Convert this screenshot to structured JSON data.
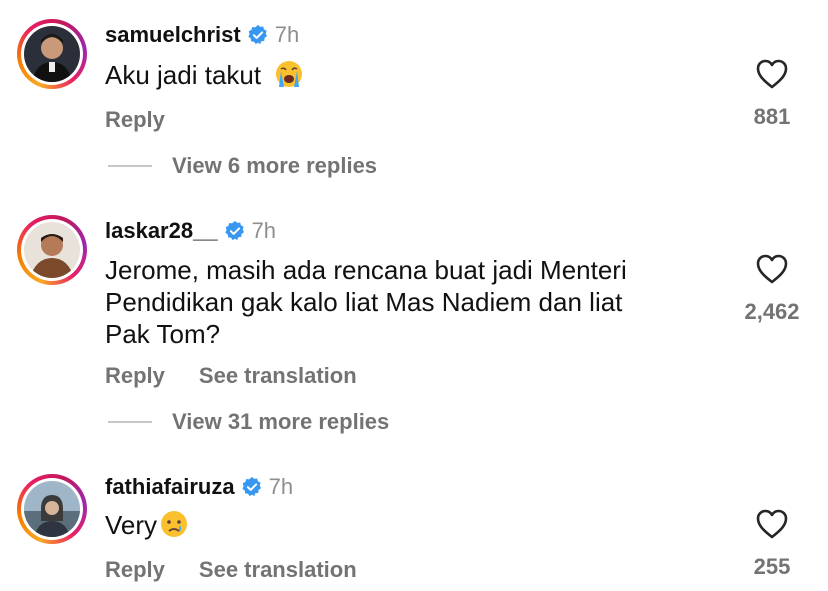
{
  "comments": [
    {
      "username": "samuelchrist",
      "time": "7h",
      "text": "Aku jadi takut",
      "emoji": "loudly-crying-face",
      "reply_label": "Reply",
      "like_count": "881",
      "view_more": "View 6 more replies"
    },
    {
      "username": "laskar28__",
      "time": "7h",
      "text_lines": [
        "Jerome, masih ada rencana buat jadi Menteri",
        "Pendidikan gak kalo liat Mas Nadiem dan liat",
        "Pak Tom?"
      ],
      "reply_label": "Reply",
      "translate_label": "See translation",
      "like_count": "2,462",
      "view_more": "View 31 more replies"
    },
    {
      "username": "fathiafairuza",
      "time": "7h",
      "text": "Very",
      "emoji": "crying-face",
      "reply_label": "Reply",
      "translate_label": "See translation",
      "like_count": "255"
    }
  ],
  "colors": {
    "verified": "#3897f0",
    "secondary_text": "#737373",
    "primary_text": "#111111"
  }
}
